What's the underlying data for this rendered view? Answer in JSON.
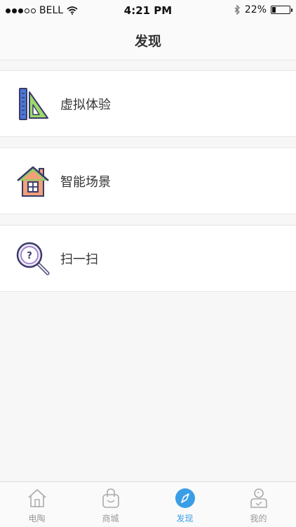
{
  "status_bar": {
    "carrier": "BELL",
    "time": "4:21 PM",
    "battery_percent": "22%",
    "battery_level": 0.22,
    "signal_bars_filled": 3,
    "signal_bars_total": 5
  },
  "nav": {
    "title": "发现"
  },
  "items": [
    {
      "label": "虚拟体验",
      "icon": "ruler-triangle-icon"
    },
    {
      "label": "智能场景",
      "icon": "house-icon"
    },
    {
      "label": "扫一扫",
      "icon": "magnifier-question-icon"
    }
  ],
  "tabs": [
    {
      "label": "电陶",
      "icon": "home-icon",
      "active": false
    },
    {
      "label": "商城",
      "icon": "shopping-bag-icon",
      "active": false
    },
    {
      "label": "发现",
      "icon": "compass-icon",
      "active": true
    },
    {
      "label": "我的",
      "icon": "user-icon",
      "active": false
    }
  ],
  "colors": {
    "accent": "#3a9ee6",
    "tab_inactive": "#999999",
    "background": "#f7f7f7"
  }
}
